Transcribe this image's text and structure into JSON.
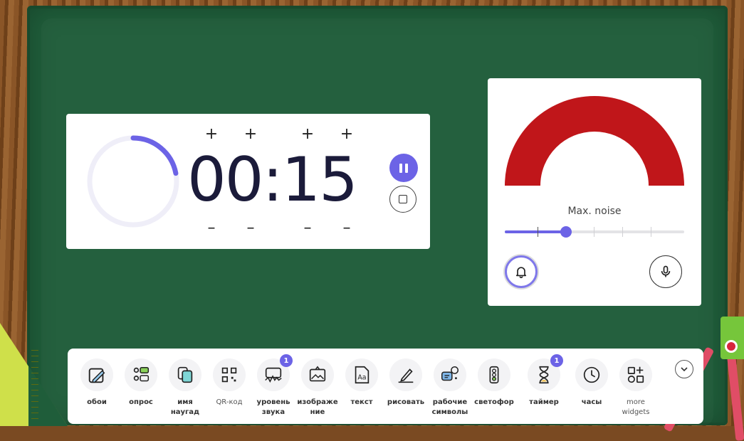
{
  "timer": {
    "minutes": "00",
    "separator": ":",
    "seconds": "15",
    "plus_symbol": "+",
    "minus_symbol": "–",
    "progress_fraction": 0.22,
    "pause_icon": "pause-icon",
    "stop_icon": "stop-icon"
  },
  "noise_meter": {
    "gauge_color": "#c0161a",
    "label": "Max. noise",
    "slider_value_fraction": 0.34,
    "bell_icon": "bell-icon",
    "mic_icon": "microphone-icon"
  },
  "colors": {
    "accent": "#6c63e6",
    "board": "#1f5d3a"
  },
  "dock": {
    "items": [
      {
        "label": "обои",
        "icon": "wallpaper-icon"
      },
      {
        "label": "опрос",
        "icon": "poll-icon"
      },
      {
        "label": "имя наугад",
        "icon": "random-name-icon"
      },
      {
        "label": "QR-код",
        "icon": "qr-code-icon"
      },
      {
        "label": "уровень звука",
        "icon": "sound-level-icon",
        "badge": "1"
      },
      {
        "label": "изображе ние",
        "icon": "image-icon"
      },
      {
        "label": "текст",
        "icon": "text-icon"
      },
      {
        "label": "рисовать",
        "icon": "draw-icon"
      },
      {
        "label": "рабочие символы",
        "icon": "work-symbols-icon"
      },
      {
        "label": "светофор",
        "icon": "traffic-light-icon"
      },
      {
        "label": "таймер",
        "icon": "hourglass-icon",
        "badge": "1"
      },
      {
        "label": "часы",
        "icon": "clock-icon"
      },
      {
        "label": "more widgets",
        "icon": "more-widgets-icon"
      }
    ],
    "collapse_icon": "chevron-down-icon"
  }
}
